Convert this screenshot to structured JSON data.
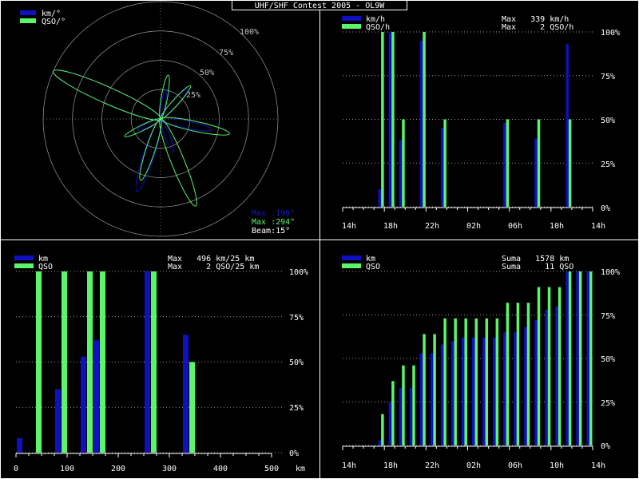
{
  "window": {
    "title": "UHF/SHF Contest 2005 - OL9W"
  },
  "colors": {
    "blue": "#1010c0",
    "green": "#5af56a",
    "grid": "#9a9a9a",
    "frame": "#ffffff"
  },
  "charts": {
    "polar": {
      "legend": [
        "km/°",
        "QSO/°"
      ],
      "ring_labels": [
        "25%",
        "50%",
        "75%",
        "100%"
      ],
      "info": [
        "Max :198°",
        "Max :294°",
        "Beam:15°"
      ]
    },
    "hourly": {
      "legend": [
        "km/h",
        "QSO/h"
      ],
      "max_lines": [
        "Max   339 km/h",
        "Max     2 QSO/h"
      ],
      "ylabels": [
        "100%",
        "75%",
        "50%",
        "25%",
        "0%"
      ],
      "xlabels": [
        "14h",
        "18h",
        "22h",
        "02h",
        "06h",
        "10h",
        "14h"
      ]
    },
    "distance": {
      "legend": [
        "km",
        "QSO"
      ],
      "max_lines": [
        "Max   496 km/25 km",
        "Max     2 QSO/25 km"
      ],
      "ylabels": [
        "100%",
        "75%",
        "50%",
        "25%",
        "0%"
      ],
      "xlabels": [
        "0",
        "100",
        "200",
        "300",
        "400",
        "500"
      ],
      "xunit": "km"
    },
    "cumulative": {
      "legend": [
        "km",
        "QSO"
      ],
      "max_lines": [
        "Suma   1578 km",
        "Suma     11 QSO"
      ],
      "ylabels": [
        "100%",
        "75%",
        "50%",
        "25%",
        "0%"
      ],
      "xlabels": [
        "14h",
        "18h",
        "22h",
        "02h",
        "06h",
        "10h",
        "14h"
      ]
    }
  },
  "chart_data": [
    {
      "type": "polar",
      "theta_unit": "deg",
      "r_unit": "percent",
      "rlim": [
        0,
        100
      ],
      "series": [
        {
          "name": "km/°",
          "points": [
            [
              294,
              100
            ],
            [
              198,
              65
            ],
            [
              102,
              45
            ],
            [
              42,
              35
            ],
            [
              158,
              30
            ],
            [
              10,
              25
            ],
            [
              244,
              22
            ]
          ]
        },
        {
          "name": "QSO/°",
          "points": [
            [
              294,
              100
            ],
            [
              158,
              80
            ],
            [
              102,
              60
            ],
            [
              198,
              55
            ],
            [
              10,
              38
            ],
            [
              42,
              38
            ],
            [
              244,
              34
            ]
          ]
        }
      ]
    },
    {
      "type": "bar",
      "categories": [
        "14h",
        "15h",
        "16h",
        "17h",
        "18h",
        "19h",
        "20h",
        "21h",
        "22h",
        "23h",
        "00h",
        "01h",
        "02h",
        "03h",
        "04h",
        "05h",
        "06h",
        "07h",
        "08h",
        "09h",
        "10h",
        "11h",
        "12h",
        "13h"
      ],
      "ylim": [
        0,
        100
      ],
      "series": [
        {
          "name": "km/h",
          "values": [
            0,
            0,
            0,
            10,
            100,
            38,
            0,
            95,
            0,
            45,
            0,
            0,
            0,
            0,
            0,
            48,
            0,
            0,
            39,
            0,
            0,
            93,
            0,
            0
          ]
        },
        {
          "name": "QSO/h",
          "values": [
            0,
            0,
            0,
            100,
            100,
            50,
            0,
            100,
            0,
            50,
            0,
            0,
            0,
            0,
            0,
            50,
            0,
            0,
            50,
            0,
            0,
            50,
            0,
            0
          ]
        }
      ]
    },
    {
      "type": "bar",
      "categories": [
        "0",
        "25",
        "50",
        "75",
        "100",
        "125",
        "150",
        "175",
        "200",
        "225",
        "250",
        "275",
        "300",
        "325",
        "350",
        "375",
        "400",
        "425",
        "450",
        "475"
      ],
      "ylim": [
        0,
        100
      ],
      "series": [
        {
          "name": "km",
          "values": [
            8,
            0,
            0,
            35,
            0,
            53,
            62,
            0,
            0,
            0,
            100,
            0,
            0,
            65,
            0,
            0,
            0,
            0,
            0,
            0
          ]
        },
        {
          "name": "QSO",
          "values": [
            0,
            100,
            0,
            100,
            0,
            100,
            100,
            0,
            0,
            0,
            100,
            0,
            0,
            50,
            0,
            0,
            0,
            0,
            0,
            0
          ]
        }
      ]
    },
    {
      "type": "bar",
      "categories": [
        "14h",
        "15h",
        "16h",
        "17h",
        "18h",
        "19h",
        "20h",
        "21h",
        "22h",
        "23h",
        "00h",
        "01h",
        "02h",
        "03h",
        "04h",
        "05h",
        "06h",
        "07h",
        "08h",
        "09h",
        "10h",
        "11h",
        "12h",
        "13h"
      ],
      "ylim": [
        0,
        100
      ],
      "series": [
        {
          "name": "km",
          "values": [
            0,
            0,
            0,
            3,
            25,
            33,
            33,
            53,
            53,
            58,
            60,
            62,
            62,
            62,
            62,
            65,
            65,
            68,
            72,
            78,
            80,
            100,
            100,
            100
          ]
        },
        {
          "name": "QSO",
          "values": [
            0,
            0,
            0,
            18,
            37,
            46,
            46,
            64,
            64,
            73,
            73,
            73,
            73,
            73,
            73,
            82,
            82,
            82,
            91,
            91,
            91,
            100,
            100,
            100
          ]
        }
      ]
    }
  ]
}
